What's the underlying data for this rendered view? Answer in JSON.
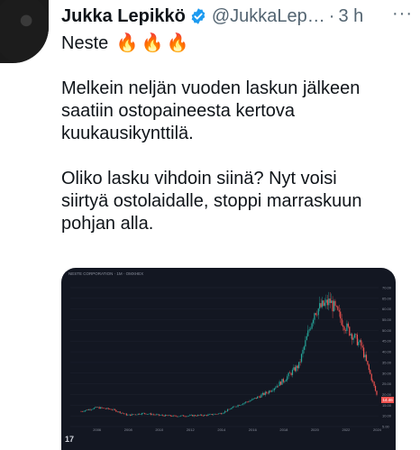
{
  "tweet": {
    "author_name": "Jukka Lepikkö",
    "handle": "@JukkaLep…",
    "dot": "·",
    "time": "3 h",
    "more": "···",
    "title_line": "Neste",
    "fire_emojis": [
      "🔥",
      "🔥",
      "🔥"
    ],
    "paragraph1": [
      "Melkein neljän vuoden laskun jälkeen",
      "saatiin ostopaineesta kertova",
      "kuukausikynttilä."
    ],
    "paragraph2": [
      "Oliko lasku vihdoin siinä? Nyt voisi",
      "siirtyä ostolaidalle, stoppi marraskuun",
      "pohjan alla."
    ]
  },
  "colors": {
    "accent_blue": "#1d9bf0",
    "chart_bg": "#131722",
    "candle_up": "#26a69a",
    "candle_down": "#ef5350"
  },
  "chart_image": {
    "header_text": "NESTE CORPORATION · 1M · OMXHEX",
    "x_ticks": [
      "2006",
      "2008",
      "2010",
      "2012",
      "2014",
      "2016",
      "2018",
      "2020",
      "2022",
      "2024"
    ],
    "y_ticks": [
      "70.00",
      "65.00",
      "60.00",
      "55.00",
      "50.00",
      "45.00",
      "40.00",
      "35.00",
      "30.00",
      "25.00",
      "20.00",
      "15.00",
      "10.00",
      "5.00"
    ],
    "price_label": "14.46",
    "logo_text": "17"
  },
  "chart_data": {
    "type": "line",
    "x": [
      2005,
      2006,
      2007,
      2008,
      2009,
      2010,
      2011,
      2012,
      2013,
      2014,
      2015,
      2016,
      2017,
      2018,
      2019,
      2020,
      2021,
      2022,
      2023,
      2024
    ],
    "series": [
      {
        "values": [
          6,
          8,
          7,
          4,
          5,
          4,
          3.5,
          3.8,
          4,
          5,
          9,
          12,
          16,
          22,
          30,
          58,
          63,
          50,
          40,
          14.5
        ]
      }
    ],
    "ylim": [
      0,
      72
    ]
  }
}
